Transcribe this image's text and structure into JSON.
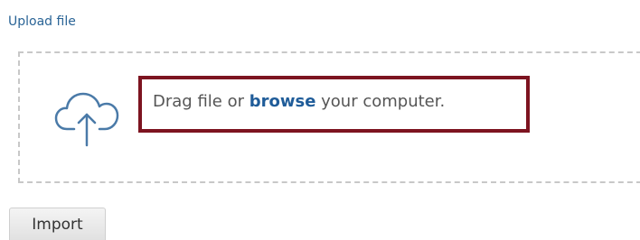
{
  "upload": {
    "section_label": "Upload file",
    "drop_text_before": "Drag file or ",
    "browse_link": "browse",
    "drop_text_after": " your computer.",
    "icon": "cloud-upload-icon"
  },
  "actions": {
    "import_label": "Import"
  },
  "colors": {
    "label_blue": "#2a6496",
    "link_blue": "#1f5c99",
    "highlight_border": "#7d1420",
    "dash_border": "#c8c8c8"
  }
}
